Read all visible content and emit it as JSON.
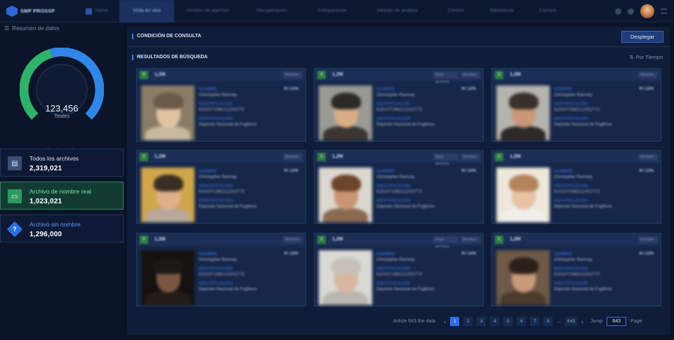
{
  "app": {
    "logo_text": "SMP PROSSP"
  },
  "nav": {
    "items": [
      {
        "label": "Home",
        "active": false
      },
      {
        "label": "Vista en vivo",
        "active": true
      },
      {
        "label": "Gestión de alarmas",
        "active": false
      },
      {
        "label": "Recuperación",
        "active": false
      },
      {
        "label": "Comparacion",
        "active": false
      },
      {
        "label": "Método de análisis",
        "active": false
      },
      {
        "label": "Control",
        "active": false
      },
      {
        "label": "Bibliotecas",
        "active": false
      },
      {
        "label": "Cámara",
        "active": false
      }
    ]
  },
  "sidebar": {
    "title": "Resumen de datos",
    "total_value": "123,456",
    "total_label": "Totales",
    "legend": [
      {
        "label": "Archivo de nombre real",
        "color": "#2fb36a"
      },
      {
        "label": "Archivo sin nombre",
        "color": "#2f86e8"
      }
    ],
    "donut": {
      "real_fraction": 0.44,
      "anon_fraction": 0.56,
      "real_color": "#2fb36a",
      "anon_color": "#2f86e8"
    },
    "stats": [
      {
        "label": "Todos los archivos",
        "value": "2,319,021",
        "icon": "document-icon"
      },
      {
        "label": "Archivo de nombre real",
        "value": "1,023,021",
        "icon": "id-card-icon"
      },
      {
        "label": "Archivo sin nombre",
        "value": "1,296,000",
        "icon": "question-icon"
      }
    ]
  },
  "query": {
    "title": "CONDICIÓN DE CONSULTA",
    "expand_label": "Desplegar"
  },
  "results": {
    "title": "RESULTADOS DE BÚSQUEDA",
    "sort_label": "Por Tiempo",
    "field_name": "NOMBRE",
    "field_id": "IDENTIFICACIÓN",
    "field_source": "IDENTIFICACIÓN",
    "cards": [
      {
        "badge": "X",
        "count": "1,2M",
        "tags": [
          "Nombre"
        ],
        "percent": "97.12%",
        "name": "Christopher Ramsey",
        "id": "510107198212202772",
        "source": "Depósito Nacional de Fugitivos"
      },
      {
        "badge": "X",
        "count": "1,2M",
        "tags": [
          "Real persona",
          "Nombre"
        ],
        "percent": "97.12%",
        "name": "Christopher Ramsey",
        "id": "510107198212202772",
        "source": "Depósito Nacional de Fugitivos"
      },
      {
        "badge": "X",
        "count": "1,2M",
        "tags": [
          "Nombre"
        ],
        "percent": "97.12%",
        "name": "Christopher Ramsey",
        "id": "510107198212202772",
        "source": "Depósito Nacional de Fugitivos"
      },
      {
        "badge": "X",
        "count": "1,2M",
        "tags": [
          "Nombre"
        ],
        "percent": "97.12%",
        "name": "Christopher Ramsey",
        "id": "510107198212202772",
        "source": "Depósito Nacional de Fugitivos"
      },
      {
        "badge": "X",
        "count": "1,2M",
        "tags": [
          "Real persona",
          "Nombre"
        ],
        "percent": "97.12%",
        "name": "Christopher Ramsey",
        "id": "510107198212202772",
        "source": "Depósito Nacional de Fugitivos"
      },
      {
        "badge": "X",
        "count": "1,2M",
        "tags": [
          "Nombre"
        ],
        "percent": "97.12%",
        "name": "Christopher Ramsey",
        "id": "510107198212202772",
        "source": "Depósito Nacional de Fugitivos"
      },
      {
        "badge": "X",
        "count": "1,2M",
        "tags": [
          "Nombre"
        ],
        "percent": "97.12%",
        "name": "Christopher Ramsey",
        "id": "510107198212202772",
        "source": "Depósito Nacional de Fugitivos"
      },
      {
        "badge": "X",
        "count": "1,2M",
        "tags": [
          "Real persona",
          "Nombre"
        ],
        "percent": "97.12%",
        "name": "Christopher Ramsey",
        "id": "510107198212202772",
        "source": "Depósito Nacional de Fugitivos"
      },
      {
        "badge": "X",
        "count": "1,2M",
        "tags": [
          "Nombre"
        ],
        "percent": "97.12%",
        "name": "Christopher Ramsey",
        "id": "510107198212202772",
        "source": "Depósito Nacional de Fugitivos"
      }
    ]
  },
  "pagination": {
    "summary": "Article 643 the data",
    "pages": [
      "1",
      "2",
      "3",
      "4",
      "5",
      "6",
      "7",
      "8",
      "...",
      "643"
    ],
    "current": "1",
    "jump_label": "Jump",
    "jump_value": "643",
    "page_label": "Page"
  }
}
